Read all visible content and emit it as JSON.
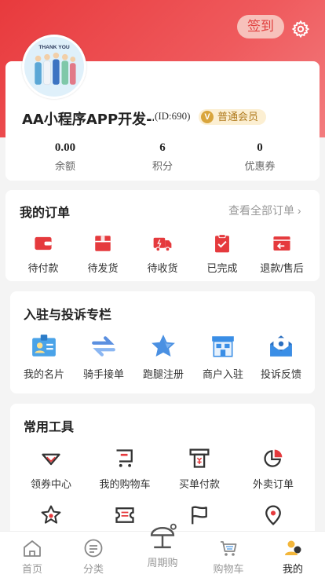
{
  "header": {
    "signin_label": "签到"
  },
  "profile": {
    "name": "AA小程序APP开发---",
    "id_text": "(ID:690)",
    "member_badge": "普通会员",
    "avatar_caption": "THANK YOU",
    "stats": [
      {
        "value": "0.00",
        "label": "余额"
      },
      {
        "value": "6",
        "label": "积分"
      },
      {
        "value": "0",
        "label": "优惠券"
      }
    ]
  },
  "orders": {
    "title": "我的订单",
    "view_all": "查看全部订单",
    "items": [
      {
        "label": "待付款",
        "icon": "wallet-icon"
      },
      {
        "label": "待发货",
        "icon": "package-icon"
      },
      {
        "label": "待收货",
        "icon": "truck-icon"
      },
      {
        "label": "已完成",
        "icon": "clipboard-check-icon"
      },
      {
        "label": "退款/售后",
        "icon": "return-icon"
      }
    ]
  },
  "complaints": {
    "title": "入驻与投诉专栏",
    "items": [
      {
        "label": "我的名片",
        "icon": "id-card-icon"
      },
      {
        "label": "骑手接单",
        "icon": "swap-icon"
      },
      {
        "label": "跑腿注册",
        "icon": "star-icon"
      },
      {
        "label": "商户入驻",
        "icon": "store-icon"
      },
      {
        "label": "投诉反馈",
        "icon": "mail-icon"
      }
    ]
  },
  "tools": {
    "title": "常用工具",
    "items": [
      {
        "label": "领券中心",
        "icon": "diamond-icon"
      },
      {
        "label": "我的购物车",
        "icon": "cart-icon"
      },
      {
        "label": "买单付款",
        "icon": "receipt-icon"
      },
      {
        "label": "外卖订单",
        "icon": "pie-chart-icon"
      },
      {
        "label": "",
        "icon": "star-badge-icon"
      },
      {
        "label": "",
        "icon": "ticket-icon"
      },
      {
        "label": "",
        "icon": "flag-icon"
      },
      {
        "label": "",
        "icon": "location-icon"
      }
    ]
  },
  "tabbar": {
    "items": [
      {
        "label": "首页",
        "icon": "home-icon"
      },
      {
        "label": "分类",
        "icon": "category-icon"
      },
      {
        "label": "周期购",
        "icon": "beach-icon"
      },
      {
        "label": "购物车",
        "icon": "cart-icon"
      },
      {
        "label": "我的",
        "icon": "user-icon"
      }
    ],
    "active": "我的"
  },
  "colors": {
    "accent": "#e53a3d",
    "badge_bg": "#fcefd2",
    "gold": "#d9a53c",
    "blue": "#3a8ee6"
  }
}
